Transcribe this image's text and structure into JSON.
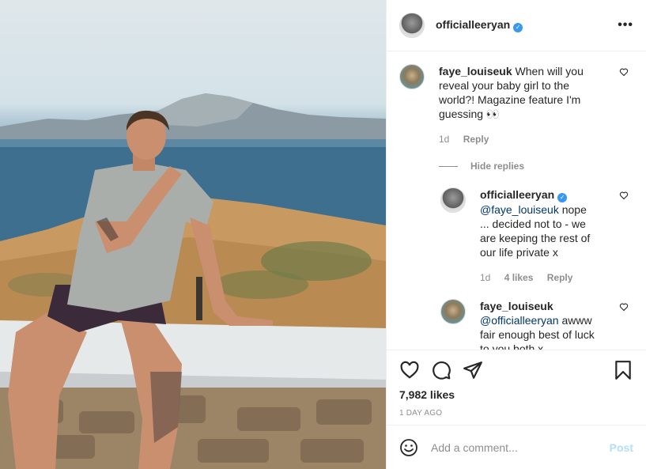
{
  "post": {
    "author": "officialleeryan",
    "more_icon": "more-horizontal-icon"
  },
  "comments": [
    {
      "user": "faye_louiseuk",
      "text": "When will you reveal your baby girl to the world?! Magazine feature I'm guessing 👀",
      "time": "1d",
      "reply_label": "Reply"
    }
  ],
  "hide_replies": "Hide replies",
  "replies": [
    {
      "user": "officialleeryan",
      "mention": "@faye_louiseuk",
      "text": "nope ... decided not to - we are keeping the rest of our life private x",
      "time": "1d",
      "likes": "4 likes",
      "reply_label": "Reply"
    },
    {
      "user": "faye_louiseuk",
      "mention": "@officialleeryan",
      "text": "awww fair enough best of luck to you both x"
    }
  ],
  "actions": {
    "likes": "7,982 likes",
    "date": "1 DAY AGO"
  },
  "composer": {
    "placeholder": "Add a comment...",
    "post_label": "Post"
  },
  "colors": {
    "verified": "#3897f0",
    "post_disabled": "#b2dffc",
    "mention": "#00376b"
  }
}
